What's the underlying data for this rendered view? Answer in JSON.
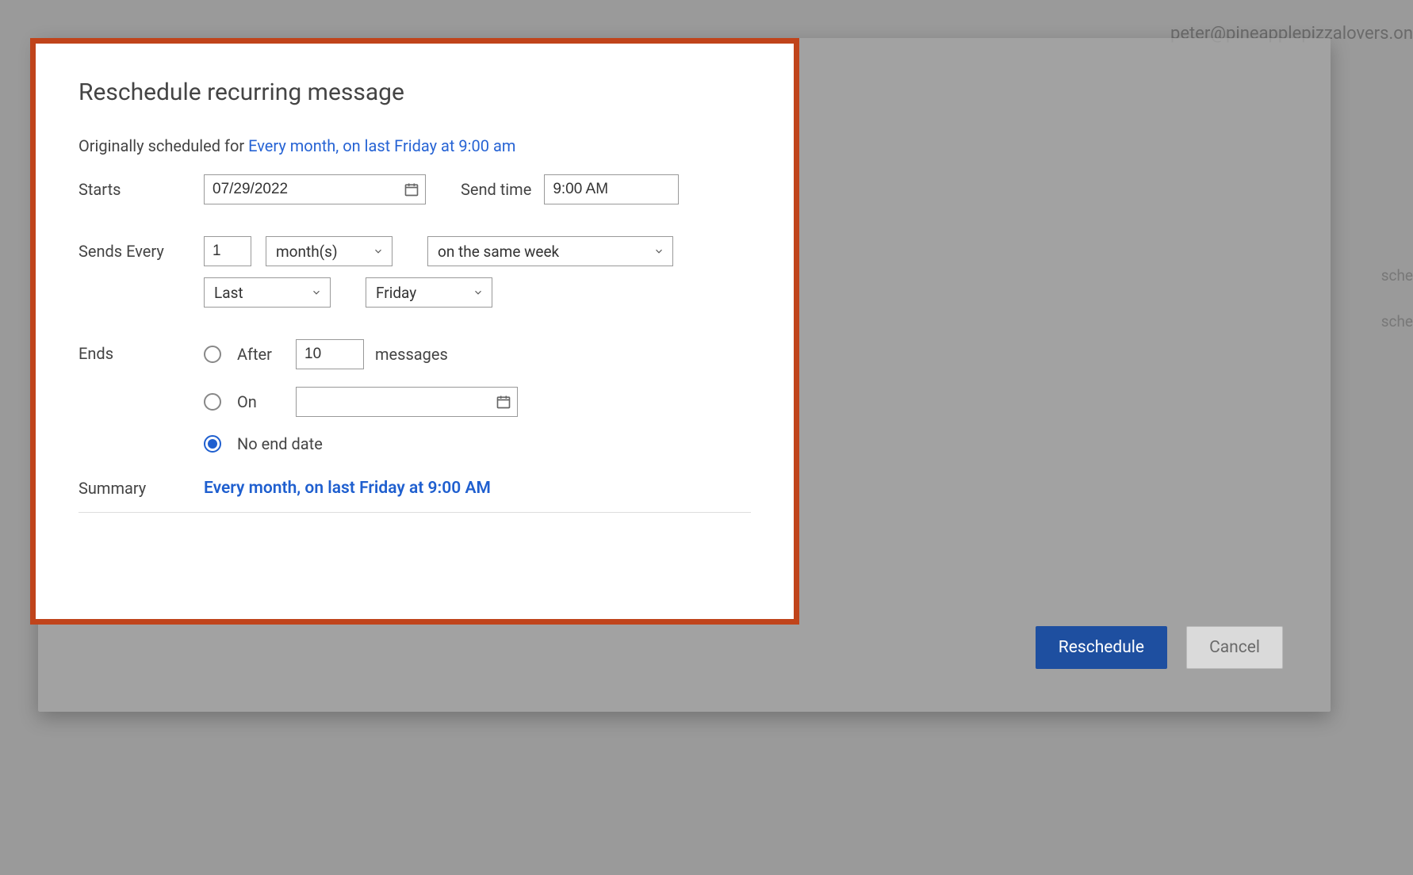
{
  "background": {
    "email": "peter@pineapplepizzalovers.on",
    "right_hint_1": "sche",
    "right_hint_2": "sche"
  },
  "dialog": {
    "title": "Reschedule recurring message",
    "originally_prefix": "Originally scheduled for ",
    "originally_link": "Every month, on last Friday at 9:00 am",
    "labels": {
      "starts": "Starts",
      "send_time": "Send time",
      "sends_every": "Sends Every",
      "ends": "Ends",
      "summary": "Summary"
    },
    "starts_date": "07/29/2022",
    "send_time_value": "9:00 AM",
    "sends_every_count": "1",
    "sends_every_unit": "month(s)",
    "sends_every_pattern": "on the same week",
    "week_ordinal": "Last",
    "weekday": "Friday",
    "ends": {
      "after_label": "After",
      "after_count": "10",
      "after_suffix": "messages",
      "on_label": "On",
      "on_date": "",
      "no_end_label": "No end date",
      "selected": "no_end"
    },
    "summary_text": "Every month, on last Friday at 9:00 AM"
  },
  "footer": {
    "reschedule": "Reschedule",
    "cancel": "Cancel"
  }
}
